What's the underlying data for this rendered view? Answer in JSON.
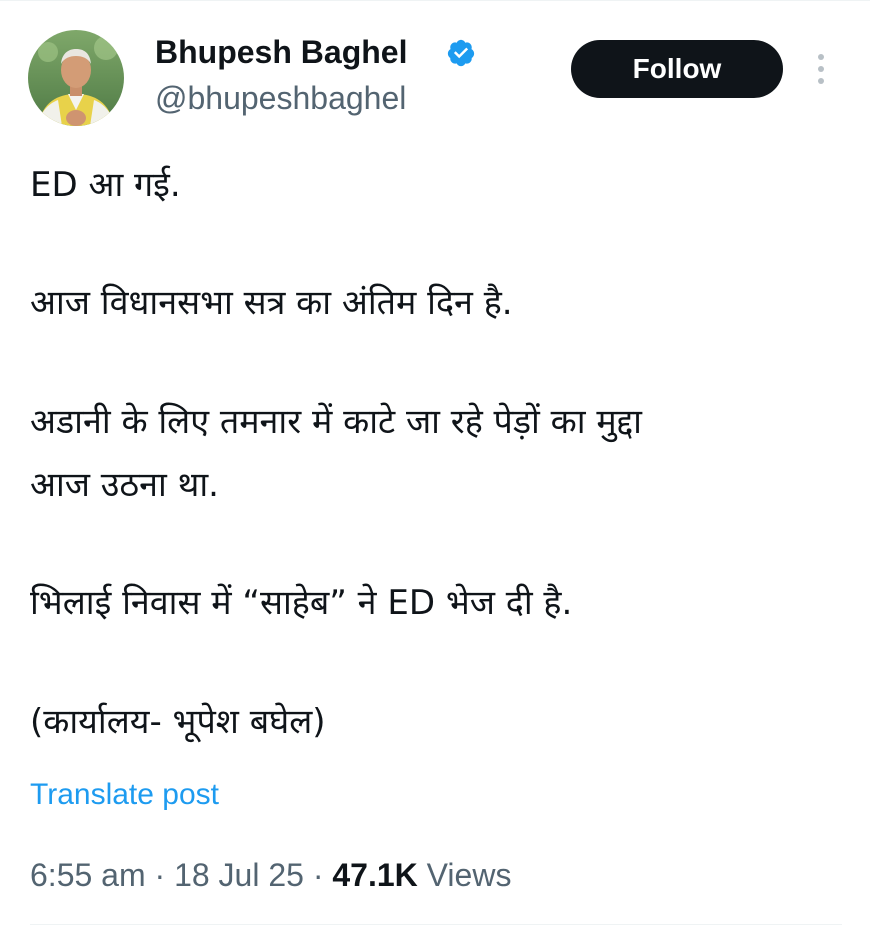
{
  "author": {
    "name": "Bhupesh Baghel",
    "handle": "@bhupeshbaghel",
    "verified": true,
    "avatar_icon": "profile-photo"
  },
  "actions": {
    "follow_label": "Follow",
    "more_icon": "vertical-ellipsis-icon"
  },
  "post": {
    "lines": [
      "ED आ गई.",
      "आज विधानसभा सत्र का अंतिम दिन है.",
      "अडानी के लिए तमनार में काटे जा रहे पेड़ों का मुद्दा",
      "आज उठना था.",
      "भिलाई निवास में “साहेब” ने ED भेज दी है.",
      "(कार्यालय- भूपेश बघेल)"
    ],
    "translate_label": "Translate post"
  },
  "meta": {
    "time": "6:55 am",
    "separator": "·",
    "date": "18 Jul 25",
    "views_count": "47.1K",
    "views_label": "Views"
  },
  "colors": {
    "text_primary": "#0f1419",
    "text_secondary": "#536471",
    "link": "#1d9bf0",
    "verified": "#1d9bf0",
    "follow_bg": "#0f1419"
  }
}
